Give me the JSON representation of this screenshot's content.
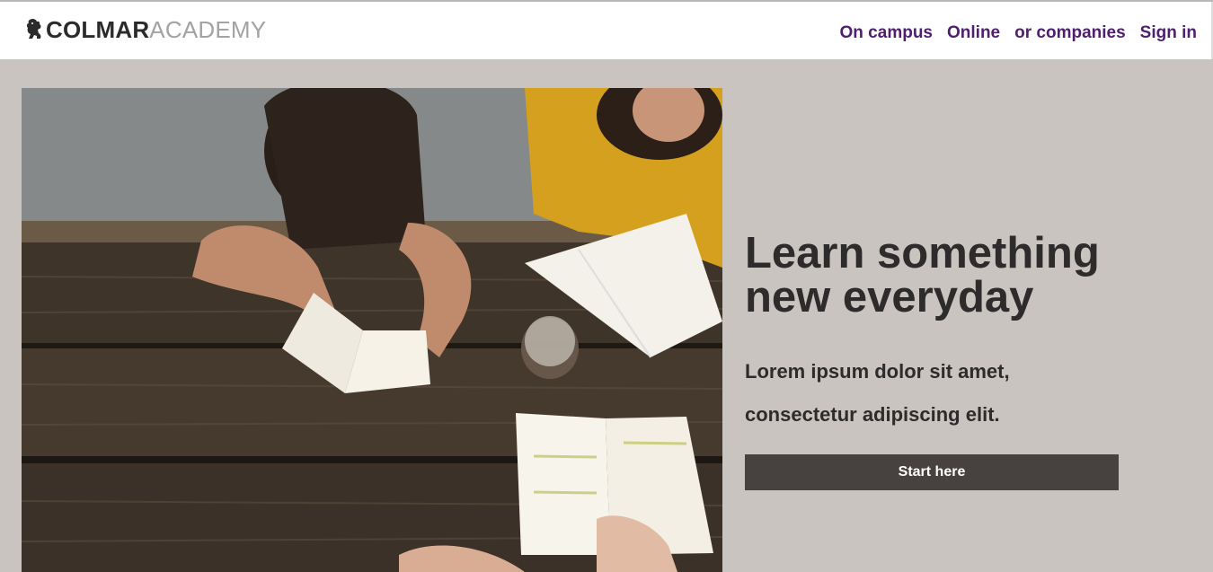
{
  "header": {
    "logo": {
      "strong": "COLMAR",
      "light": "ACADEMY",
      "icon": "lion-icon"
    },
    "nav": [
      {
        "label": "On campus"
      },
      {
        "label": "Online"
      },
      {
        "label": "or companies"
      },
      {
        "label": "Sign in"
      }
    ]
  },
  "hero": {
    "image_description_icon": "students-studying-photo",
    "title": "Learn something new everyday",
    "text_line1": "Lorem ipsum dolor sit amet,",
    "text_line2": "consectetur adipiscing elit.",
    "cta_label": "Start here"
  },
  "colors": {
    "background": "#c9c4bf",
    "nav_link": "#4f1e6e",
    "cta_bg": "#474240",
    "heading": "#2d2b2b"
  }
}
